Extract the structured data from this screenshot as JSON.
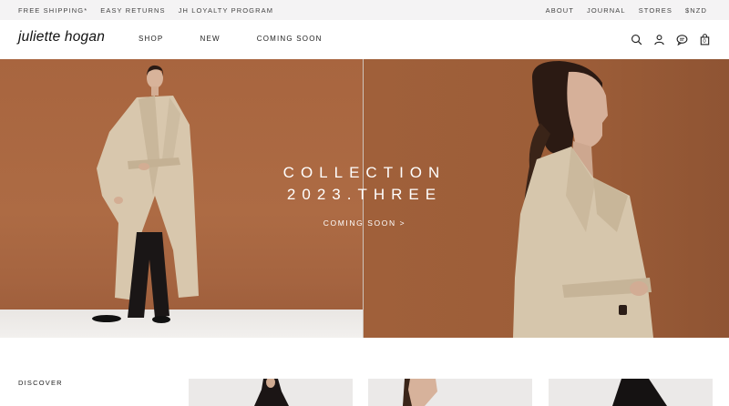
{
  "topbar": {
    "left_links": [
      "FREE SHIPPING*",
      "EASY RETURNS",
      "JH LOYALTY PROGRAM"
    ],
    "right_links": [
      "ABOUT",
      "JOURNAL",
      "STORES",
      "$NZD"
    ]
  },
  "header": {
    "logo": "juliette hogan",
    "nav": [
      "SHOP",
      "NEW",
      "COMING SOON"
    ],
    "icons": [
      "search-icon",
      "account-icon",
      "chat-icon",
      "bag-icon"
    ],
    "cart_count": "0"
  },
  "hero": {
    "title_line1": "COLLECTION",
    "title_line2": "2023.THREE",
    "cta": "COMING SOON >"
  },
  "lower": {
    "discover": "DISCOVER"
  },
  "colors": {
    "hero_bg": "#a8653f",
    "topbar_bg": "#f4f3f4"
  }
}
